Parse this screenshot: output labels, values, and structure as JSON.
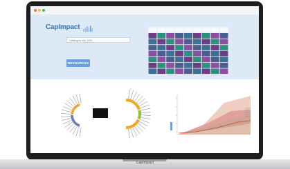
{
  "app": {
    "logo_text": "CapImpact"
  },
  "search": {
    "placeholder": "Getting to the 10%"
  },
  "button": {
    "label": "RESOURCES"
  },
  "device": {
    "brand_label": "CapImpact"
  },
  "colors": {
    "brand_blue": "#2b78c2",
    "header_band": "#dde9f7",
    "button_blue": "#6aa1dc",
    "heatmap_palette": [
      "#6b3f86",
      "#8a4fa1",
      "#3f6f93",
      "#2f8f7f",
      "#4a5f8f"
    ],
    "chord_palette": [
      "#f2a627",
      "#8fbf3b",
      "#6a7bb5"
    ],
    "area_palette": [
      "#e9b8a6",
      "#d98d8a",
      "#c9a48d",
      "#e8c9b8"
    ]
  },
  "icons": {
    "window_controls": [
      "close-dot-icon",
      "minimize-dot-icon",
      "maximize-dot-icon"
    ],
    "logo_mark": "bar-mark-icon"
  }
}
